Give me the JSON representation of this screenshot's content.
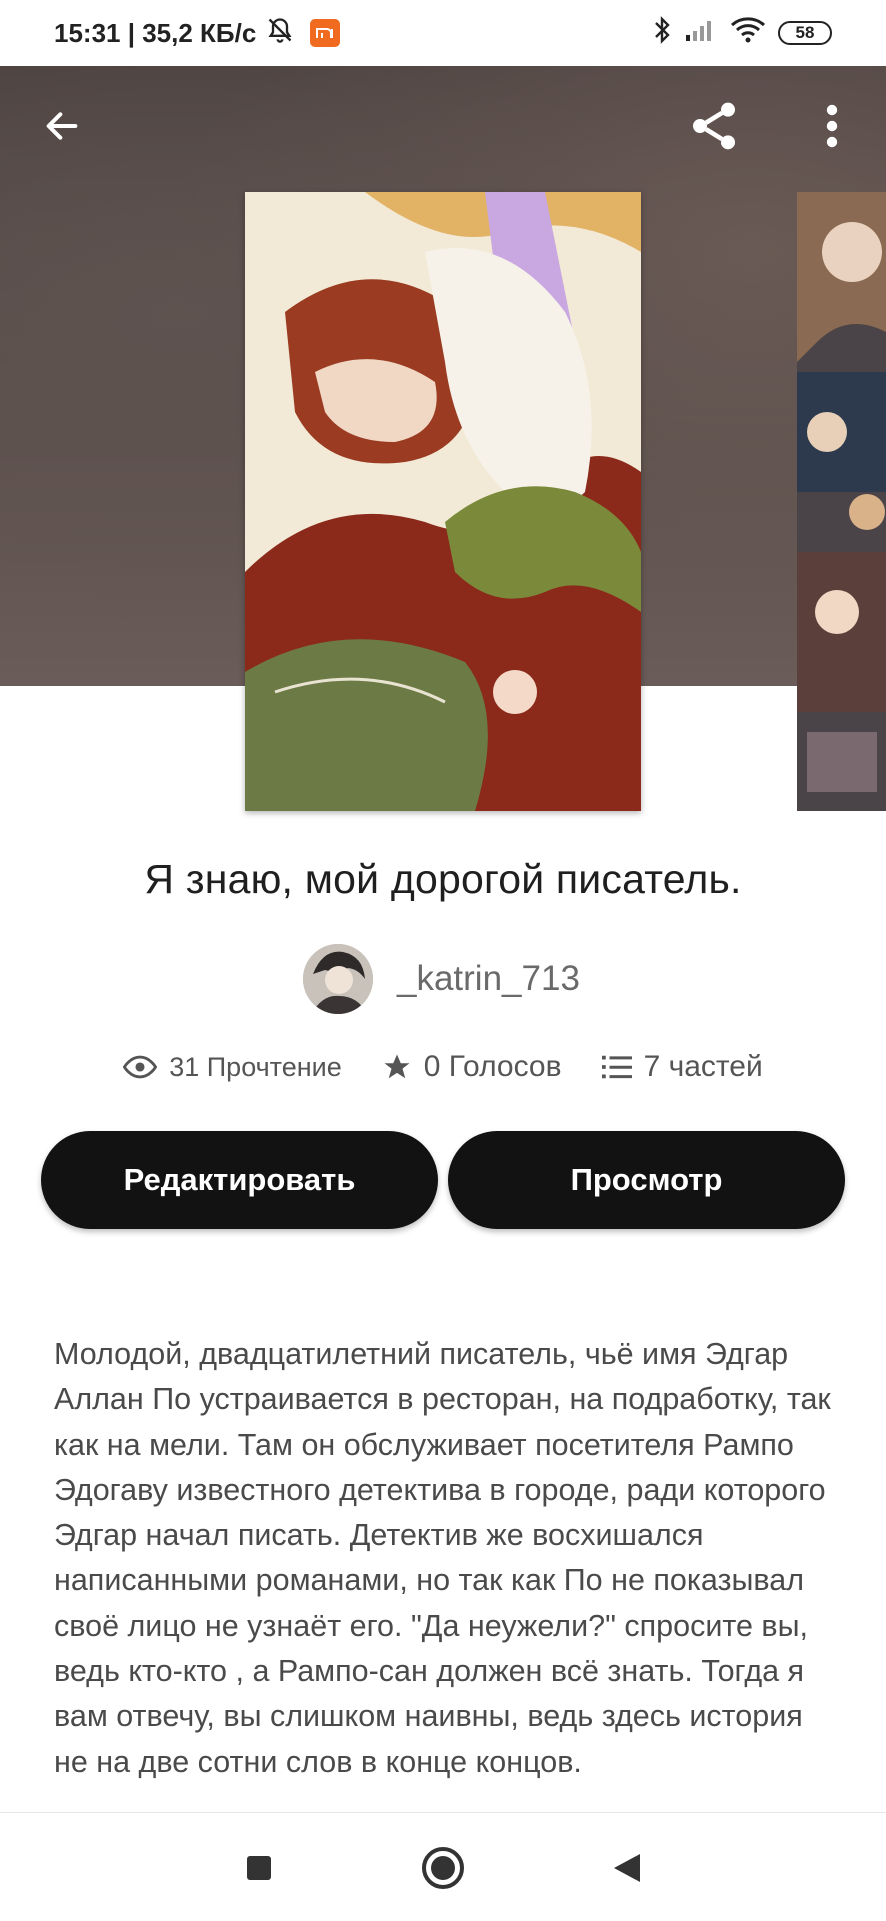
{
  "status_bar": {
    "time_speed": "15:31 | 35,2 КБ/с",
    "battery": "58",
    "icons": [
      "bell-muted-icon",
      "mi-app-icon",
      "bluetooth-icon",
      "signal-icon",
      "wifi-icon",
      "battery-icon"
    ]
  },
  "app_bar": {
    "back_icon": "arrow-left-icon",
    "share_icon": "share-icon",
    "menu_icon": "more-vertical-icon"
  },
  "story": {
    "title": "Я знаю, мой дорогой писатель.",
    "author": "_katrin_713",
    "reads": "31 Прочтение",
    "votes": "0 Голосов",
    "parts": "7 частей"
  },
  "actions": {
    "edit_label": "Редактировать",
    "view_label": "Просмотр"
  },
  "description": "Молодой, двадцатилетний писатель, чьё имя Эдгар Аллан По устраивается в ресторан, на подработку, так как на мели. Там он обслуживает посетителя Рампо Эдогаву известного детектива в городе, ради которого Эдгар начал писать. Детектив же восхишался написанными романами, но так как По не показывал своё лицо не узнаёт его. \"Да неужели?\" спросите вы, ведь кто-кто , а Рампо-сан должен всё знать.  Тогда я вам отвечу, вы слишком наивны, ведь здесь история не на две сотни слов в конце концов.",
  "nav": {
    "icons": [
      "recents-square-icon",
      "home-circle-icon",
      "back-triangle-icon"
    ]
  }
}
